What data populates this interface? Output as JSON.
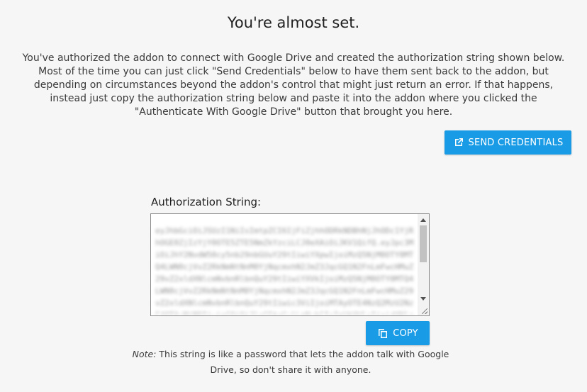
{
  "page": {
    "title": "You're almost set.",
    "intro": "You've authorized the addon to connect with Google Drive and created the authorization string shown below. Most of the time you can just click \"Send Credentials\" below to have them sent back to the addon, but depending on circumstances beyond the addon's control that might just return an error. If that happens, instead just copy the authorization string below and paste it into the addon where you clicked the \"Authenticate With Google Drive\" button that brought you here."
  },
  "send_button": {
    "label": "SEND CREDENTIALS",
    "icon": "open-in-new-icon"
  },
  "auth": {
    "label": "Authorization String:",
    "value": "eyJhbGciOiJSUzI1NiIsImtpZCI6IjFiZjhhODRkNDBhNjJhODc1YjRhOGE0ZjIzYjY0OTE5ZTE5NmZkYzciLCJ0eXAiOiJKV1QifQ.eyJpc3MiOiJhY2NvdW50cy5nb29nbGUuY29tIiwiYXpwIjoiMzQ5NjM0OTY0MTQ4LWN0cjVvZ2RkNmNtNnM0YjNqcmxhN2JmZ3JqcGQ1N2FnLmFwcHMuZ29vZ2xldXNlcmNvbnRlbnQuY29tIiwiYXVkIjoiMzQ5NjM0OTY0MTQ4LWN0cjVvZ2RkNmNtNnM0YjNqcmxhN2JmZ3JqcGQ1N2FnLmFwcHMuZ29vZ2xldXNlcmNvbnRlbnQuY29tIiwic3ViIjoiMTAyOTE4NzQ2MzU2NzE4OTAxMjM0IiwiaGQiOiJleGFtcGxlLmNvbSIsImVtYWlsIjoidXNlckBleGFtcGxlLmNvbSJ9"
  },
  "copy_button": {
    "label": "COPY",
    "icon": "copy-icon"
  },
  "note": {
    "prefix": "Note:",
    "text": " This string is like a password that lets the addon talk with Google Drive, so don't share it with anyone."
  },
  "colors": {
    "accent": "#1a9be6",
    "background": "#f6f6f6"
  }
}
